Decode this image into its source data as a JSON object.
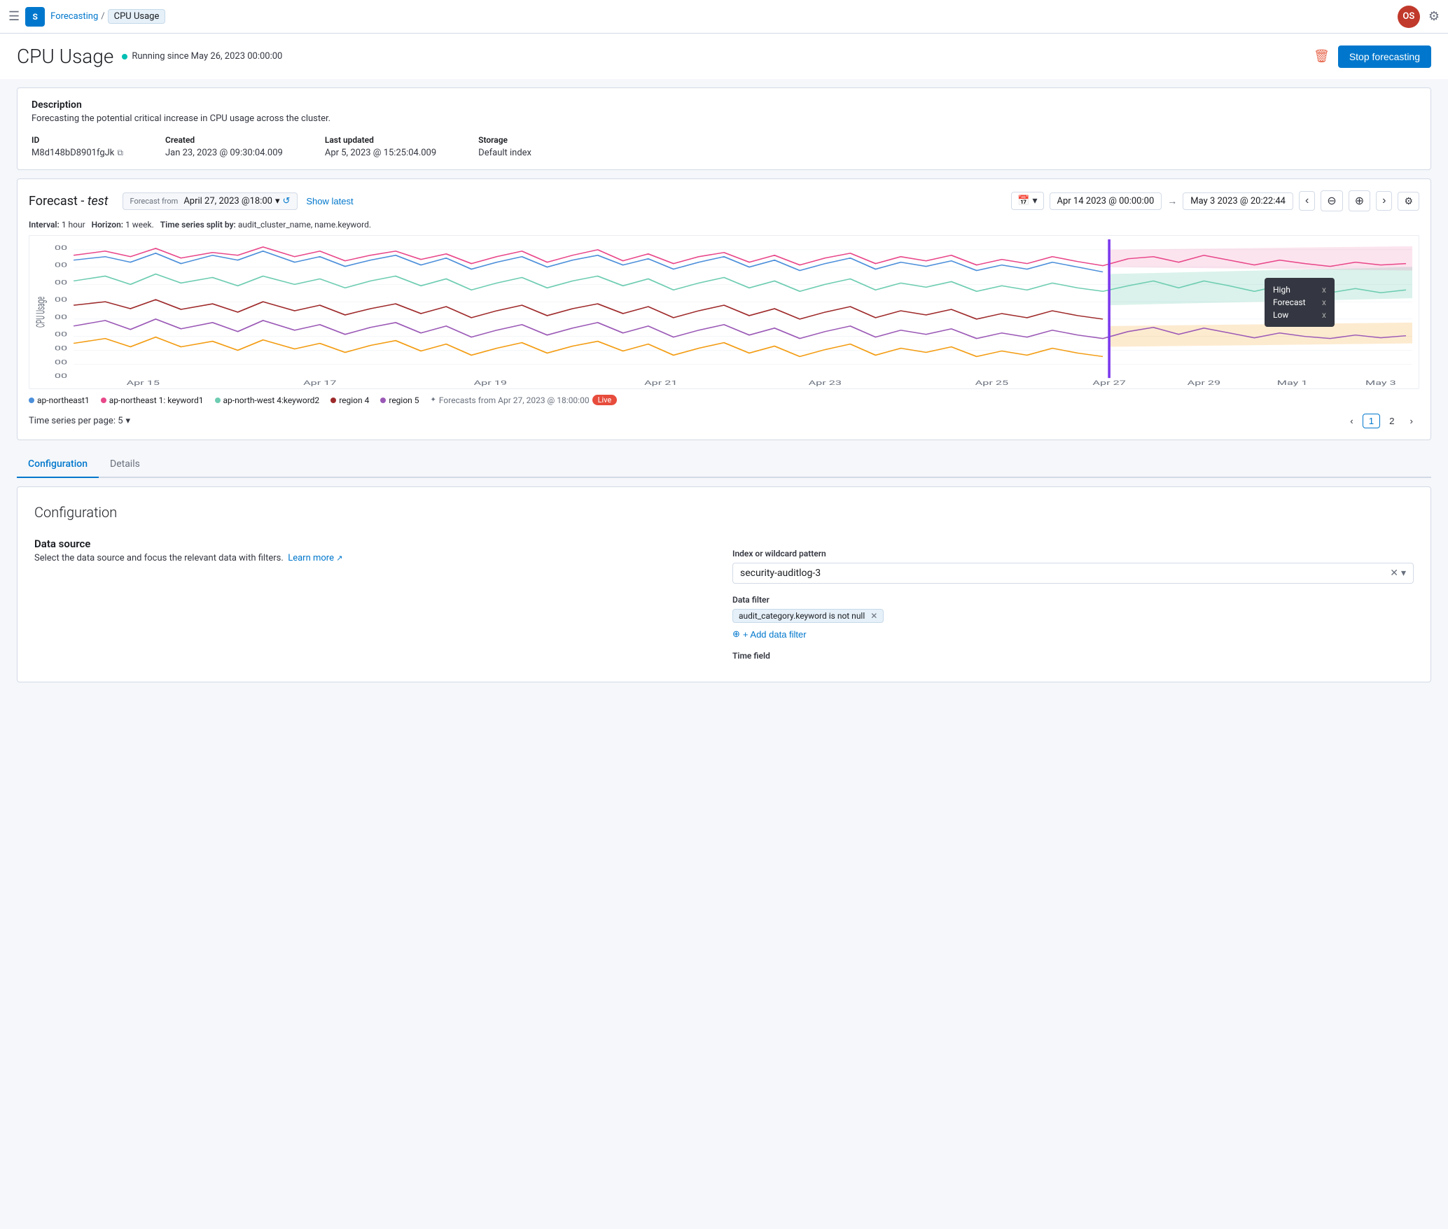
{
  "nav": {
    "hamburger": "☰",
    "logo": "S",
    "breadcrumb_link": "Forecasting",
    "breadcrumb_current": "CPU Usage",
    "avatar_initials": "OS",
    "settings_icon": "⚙"
  },
  "page": {
    "title": "CPU Usage",
    "running_since": "Running since May 26, 2023 00:00:00",
    "delete_icon": "🗑",
    "stop_btn": "Stop forecasting"
  },
  "description": {
    "title": "Description",
    "text": "Forecasting the potential critical increase in CPU usage across the cluster.",
    "id_label": "ID",
    "id_value": "M8d148bD8901fgJk",
    "created_label": "Created",
    "created_value": "Jan 23, 2023 @ 09:30:04.009",
    "updated_label": "Last updated",
    "updated_value": "Apr 5, 2023 @ 15:25:04.009",
    "storage_label": "Storage",
    "storage_value": "Default index"
  },
  "chart_panel": {
    "title_prefix": "Forecast - ",
    "title_italic": "test",
    "forecast_from_label": "Forecast from",
    "forecast_from_value": "April 27, 2023 @18:00",
    "show_latest": "Show latest",
    "date_from": "Apr 14 2023 @ 00:00:00",
    "date_to": "May 3 2023 @ 20:22:44",
    "interval_label": "Interval:",
    "interval_value": "1 hour",
    "horizon_label": "Horizon:",
    "horizon_value": "1 week.",
    "split_label": "Time series split by:",
    "split_value": "audit_cluster_name, name.keyword.",
    "tooltip": {
      "high_label": "High",
      "high_x": "x",
      "forecast_label": "Forecast",
      "forecast_x": "x",
      "low_label": "Low",
      "low_x": "x"
    },
    "legend": {
      "items": [
        {
          "label": "ap-northeast1",
          "color": "#4c8fda"
        },
        {
          "label": "ap-northeast 1: keyword1",
          "color": "#e8488a"
        },
        {
          "label": "ap-north-west 4:keyword2",
          "color": "#6dccb1"
        },
        {
          "label": "region 4",
          "color": "#9e2a2b"
        },
        {
          "label": "region 5",
          "color": "#9b59b6"
        }
      ],
      "forecasts_text": "Forecasts from Apr 27, 2023 @ 18:00:00",
      "live_badge": "Live"
    },
    "per_page_label": "Time series per page: 5",
    "pages": [
      "1",
      "2"
    ]
  },
  "tabs": [
    {
      "label": "Configuration",
      "active": true
    },
    {
      "label": "Details",
      "active": false
    }
  ],
  "configuration": {
    "title": "Configuration",
    "data_source": {
      "title": "Data source",
      "desc": "Select the data source and focus the relevant data with filters.",
      "learn_more": "Learn more",
      "index_label": "Index or wildcard pattern",
      "index_value": "security-auditlog-3",
      "filter_label": "Data filter",
      "filter_value": "audit_category.keyword is not null",
      "add_filter": "+ Add data filter",
      "time_field_label": "Time field"
    }
  }
}
